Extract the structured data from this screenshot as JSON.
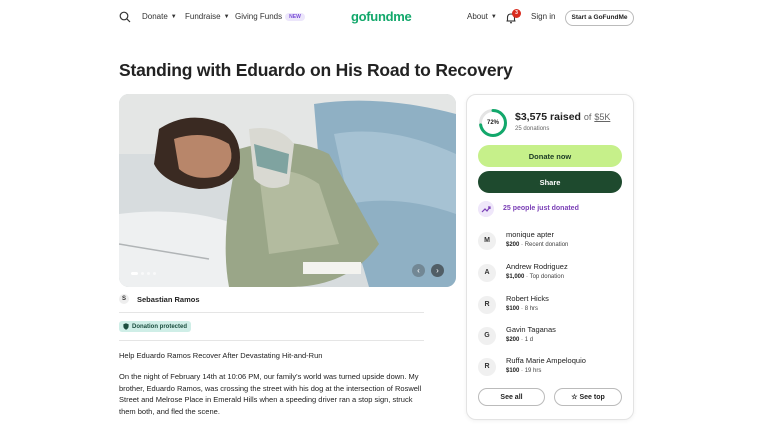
{
  "nav": {
    "donate": "Donate",
    "fundraise": "Fundraise",
    "giving_funds": "Giving Funds",
    "new_badge": "NEW",
    "logo": "gofundme",
    "about": "About",
    "notif_count": "3",
    "sign_in": "Sign in",
    "start": "Start a GoFundMe"
  },
  "campaign": {
    "title": "Standing with Eduardo on His Road to Recovery",
    "organizer_initial": "S",
    "organizer": "Sebastian Ramos",
    "protected": "Donation protected",
    "subhead": "Help Eduardo Ramos Recover After Devastating Hit-and-Run",
    "story": "On the night of February 14th at 10:06 PM, our family's world was turned upside down. My brother, Eduardo Ramos, was crossing the street with his dog at the intersection of Roswell Street and Melrose Place in Emerald Hills when a speeding driver ran a stop sign, struck them both, and fled the scene."
  },
  "progress": {
    "percent_label": "72%",
    "percent": 0.72,
    "raised": "$3,575 raised",
    "of": "of",
    "goal": "$5K",
    "donations": "25 donations"
  },
  "actions": {
    "donate": "Donate now",
    "share": "Share"
  },
  "trend": "25 people just donated",
  "donors": [
    {
      "initial": "M",
      "name": "monique apter",
      "amount": "$200",
      "meta": " · Recent donation"
    },
    {
      "initial": "A",
      "name": "Andrew Rodriguez",
      "amount": "$1,000",
      "meta": " · Top donation"
    },
    {
      "initial": "R",
      "name": "Robert Hicks",
      "amount": "$100",
      "meta": " · 8 hrs"
    },
    {
      "initial": "G",
      "name": "Gavin Taganas",
      "amount": "$200",
      "meta": " · 1 d"
    },
    {
      "initial": "R",
      "name": "Ruffa Marie Ampeloquio",
      "amount": "$100",
      "meta": " · 19 hrs"
    }
  ],
  "buttons": {
    "see_all": "See all",
    "see_top": "See top"
  },
  "icons": {
    "search": "search-icon",
    "bell": "bell-icon",
    "trend": "trending-up-icon",
    "shield": "shield-icon",
    "star": "star-icon"
  },
  "colors": {
    "brand": "#12a86b",
    "donate_button": "#c6f08a",
    "share_button": "#1e4a2e",
    "trend_text": "#7a3fb6",
    "protected_bg": "#cfeee7"
  }
}
